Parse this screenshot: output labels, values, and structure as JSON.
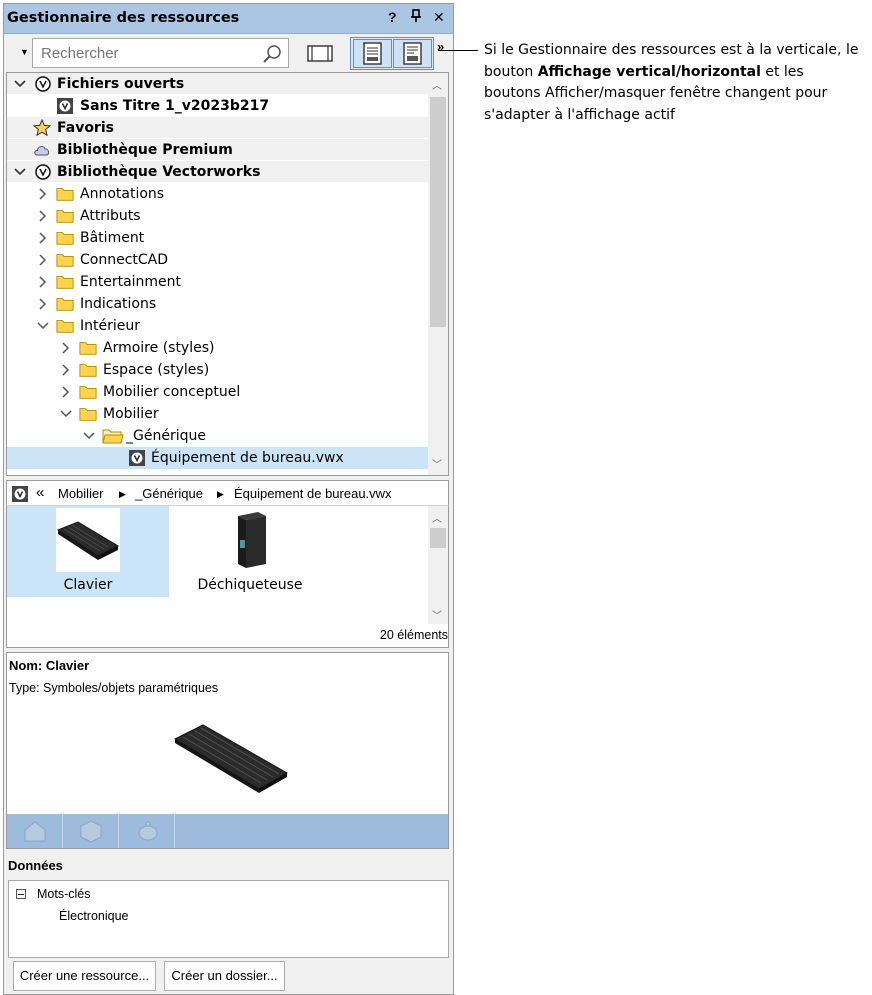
{
  "panel": {
    "title": "Gestionnaire des ressources",
    "help": "?",
    "pin": "❙",
    "close": "✕"
  },
  "toolbar": {
    "search_placeholder": "Rechercher",
    "more": "»"
  },
  "tree": {
    "open_files": "Fichiers ouverts",
    "open_file_name": "Sans Titre 1_v2023b217",
    "favorites": "Favoris",
    "premium": "Bibliothèque Premium",
    "vectorworks": "Bibliothèque Vectorworks",
    "folders": [
      "Annotations",
      "Attributs",
      "Bâtiment",
      "ConnectCAD",
      "Entertainment",
      "Indications"
    ],
    "interieur": "Intérieur",
    "interieur_children": [
      "Armoire (styles)",
      "Espace (styles)",
      "Mobilier conceptuel"
    ],
    "mobilier": "Mobilier",
    "generique": "_Générique",
    "file": "Équipement de bureau.vwx"
  },
  "breadcrumb": {
    "back": "«",
    "items": [
      "Mobilier",
      "_Générique",
      "Équipement de bureau.vwx"
    ]
  },
  "thumbnails": {
    "items": [
      {
        "label": "Clavier",
        "selected": true,
        "icon": "keyboard"
      },
      {
        "label": "Déchiqueteuse",
        "selected": false,
        "icon": "shredder"
      }
    ],
    "count": "20 éléments"
  },
  "details": {
    "name": "Nom: Clavier",
    "type": "Type: Symboles/objets paramétriques"
  },
  "data_section": {
    "title": "Données",
    "keywords_label": "Mots-clés",
    "keyword_value": "Électronique"
  },
  "buttons": {
    "create_resource": "Créer une ressource...",
    "create_folder": "Créer un dossier..."
  },
  "callout": {
    "before": "Si le Gestionnaire des ressources est à la verticale, le bouton ",
    "bold": "Affichage vertical/horizontal",
    "after": " et les boutons Afficher/masquer fenêtre changent pour s'adapter à l'affichage actif"
  },
  "colors": {
    "titlebar": "#aac6e2",
    "selection": "#cce4f7",
    "accent": "#5b93c9",
    "folder": "#ffd34d"
  }
}
